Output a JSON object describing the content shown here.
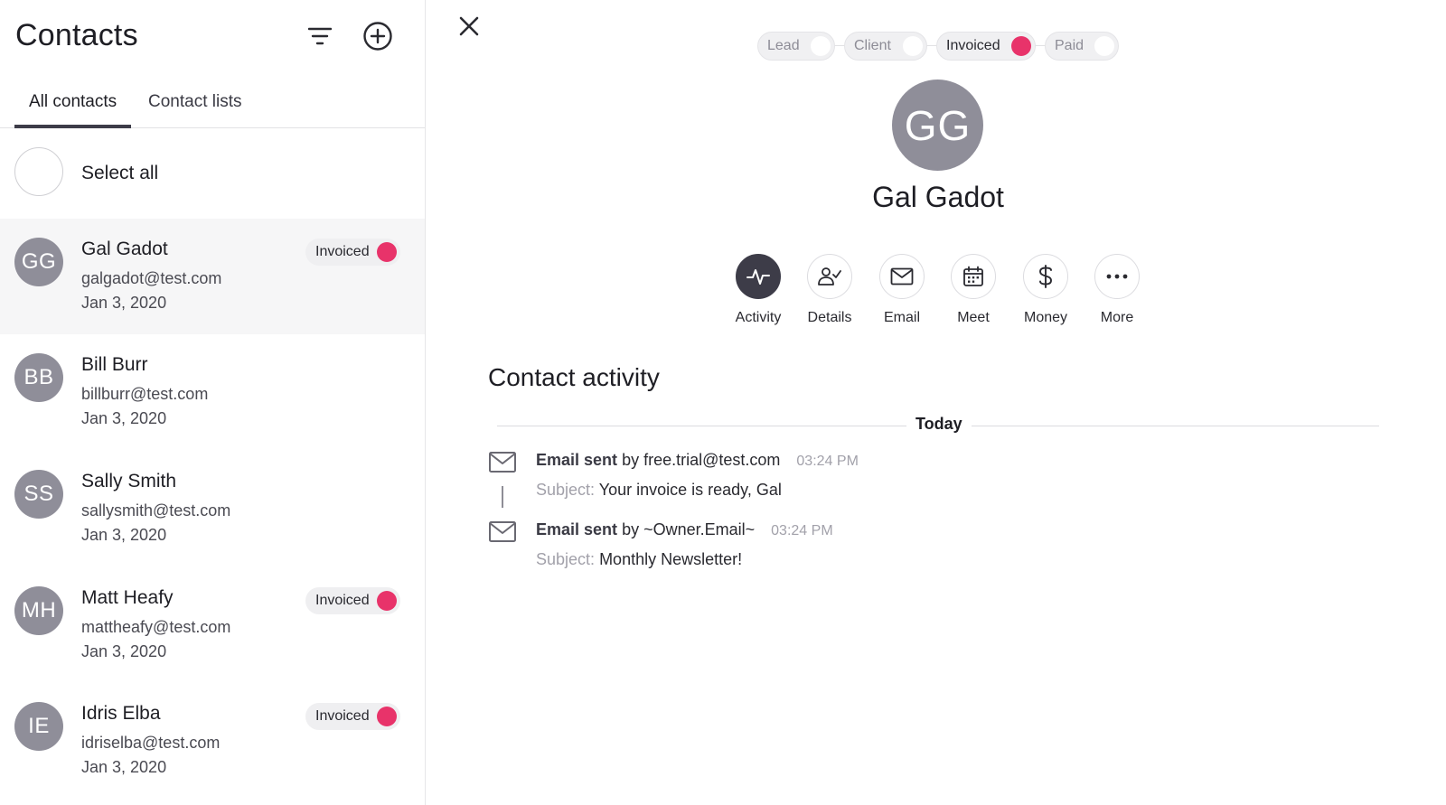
{
  "left_panel": {
    "title": "Contacts",
    "icons": {
      "filter": "filter-icon",
      "add": "add-circle-icon"
    },
    "tabs": [
      {
        "label": "All contacts",
        "active": true
      },
      {
        "label": "Contact lists",
        "active": false
      }
    ],
    "select_all_label": "Select all",
    "contacts": [
      {
        "initials": "GG",
        "name": "Gal Gadot",
        "email": "galgadot@test.com",
        "date": "Jan 3, 2020",
        "badge": "Invoiced",
        "selected": true
      },
      {
        "initials": "BB",
        "name": "Bill Burr",
        "email": "billburr@test.com",
        "date": "Jan 3, 2020",
        "badge": ""
      },
      {
        "initials": "SS",
        "name": "Sally Smith",
        "email": "sallysmith@test.com",
        "date": "Jan 3, 2020",
        "badge": ""
      },
      {
        "initials": "MH",
        "name": "Matt Heafy",
        "email": "mattheafy@test.com",
        "date": "Jan 3, 2020",
        "badge": "Invoiced"
      },
      {
        "initials": "IE",
        "name": "Idris Elba",
        "email": "idriselba@test.com",
        "date": "Jan 3, 2020",
        "badge": "Invoiced"
      }
    ]
  },
  "detail": {
    "close_icon": "close-icon",
    "stages": [
      {
        "label": "Lead",
        "active": false
      },
      {
        "label": "Client",
        "active": false
      },
      {
        "label": "Invoiced",
        "active": true
      },
      {
        "label": "Paid",
        "active": false
      }
    ],
    "initials": "GG",
    "name": "Gal Gadot",
    "actions": [
      {
        "label": "Activity",
        "icon": "activity-icon",
        "active": true
      },
      {
        "label": "Details",
        "icon": "user-check-icon",
        "active": false
      },
      {
        "label": "Email",
        "icon": "envelope-icon",
        "active": false
      },
      {
        "label": "Meet",
        "icon": "calendar-icon",
        "active": false
      },
      {
        "label": "Money",
        "icon": "dollar-icon",
        "active": false
      },
      {
        "label": "More",
        "icon": "more-dots-icon",
        "active": false
      }
    ],
    "section_title": "Contact activity",
    "day_label": "Today",
    "activities": [
      {
        "title": "Email sent",
        "by": "by",
        "sender": "free.trial@test.com",
        "time": "03:24 PM",
        "subject_label": "Subject:",
        "subject": "Your invoice is ready, Gal"
      },
      {
        "title": "Email sent",
        "by": "by",
        "sender": "~Owner.Email~",
        "time": "03:24 PM",
        "subject_label": "Subject:",
        "subject": "Monthly Newsletter!"
      }
    ]
  },
  "colors": {
    "accent_pink": "#e8336a",
    "avatar_gray": "#8f8e99",
    "dark": "#3d3c48"
  }
}
